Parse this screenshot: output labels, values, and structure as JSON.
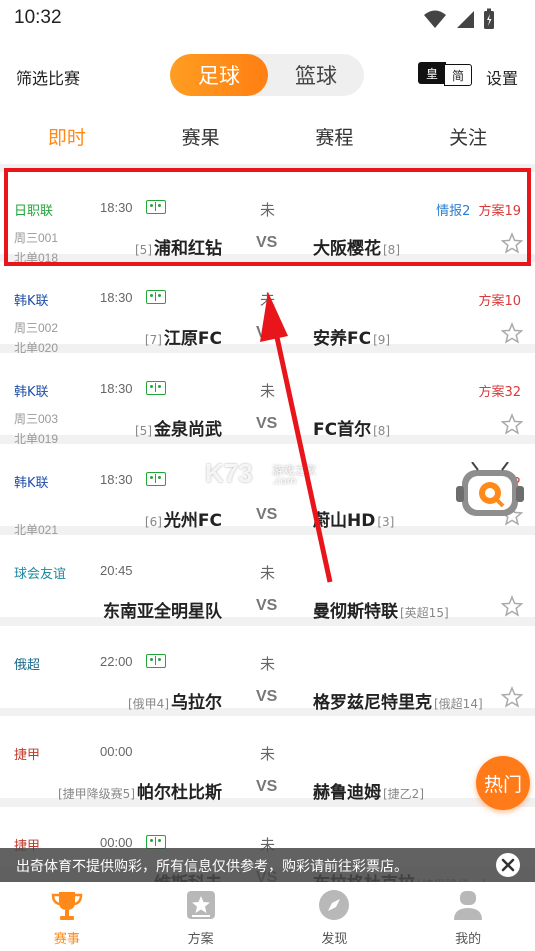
{
  "status_bar": {
    "time": "10:32"
  },
  "header": {
    "filter_label": "筛选比赛",
    "sport_tabs": [
      "足球",
      "篮球"
    ],
    "lang_trad": "皇",
    "lang_simp": "简",
    "settings_label": "设置"
  },
  "tabs": [
    "即时",
    "赛果",
    "赛程",
    "关注"
  ],
  "matches": [
    {
      "league": "日职联",
      "league_color": "#23a53a",
      "time": "18:30",
      "live": true,
      "status": "未",
      "code1": "周三001",
      "code2": "北单018",
      "home": "浦和红钻",
      "home_rank": "[5]",
      "vs": "VS",
      "away": "大阪樱花",
      "away_rank": "[8]",
      "info": "情报2",
      "plan": "方案19"
    },
    {
      "league": "韩K联",
      "league_color": "#1f4fa8",
      "time": "18:30",
      "live": true,
      "status": "未",
      "code1": "周三002",
      "code2": "北单020",
      "home": "江原FC",
      "home_rank": "[7]",
      "vs": "VS",
      "away": "安养FC",
      "away_rank": "[9]",
      "info": "",
      "plan": "方案10"
    },
    {
      "league": "韩K联",
      "league_color": "#1f4fa8",
      "time": "18:30",
      "live": true,
      "status": "未",
      "code1": "周三003",
      "code2": "北单019",
      "home": "金泉尚武",
      "home_rank": "[5]",
      "vs": "VS",
      "away": "FC首尔",
      "away_rank": "[8]",
      "info": "",
      "plan": "方案32"
    },
    {
      "league": "韩K联",
      "league_color": "#1f4fa8",
      "time": "18:30",
      "live": true,
      "status": "",
      "code1": "",
      "code2": "北单021",
      "home": "光州FC",
      "home_rank": "[6]",
      "vs": "VS",
      "away": "蔚山HD",
      "away_rank": "[3]",
      "info": "",
      "plan": "方案2"
    },
    {
      "league": "球会友谊",
      "league_color": "#1a8aa0",
      "time": "20:45",
      "live": false,
      "status": "未",
      "code1": "",
      "code2": "",
      "home": "东南亚全明星队",
      "home_rank": "",
      "vs": "VS",
      "away": "曼彻斯特联",
      "away_rank": "[英超15]",
      "info": "",
      "plan": ""
    },
    {
      "league": "俄超",
      "league_color": "#1a6a8a",
      "time": "22:00",
      "live": true,
      "status": "未",
      "code1": "",
      "code2": "",
      "home": "乌拉尔",
      "home_rank": "[俄甲4]",
      "vs": "VS",
      "away": "格罗兹尼特里克",
      "away_rank": "[俄超14]",
      "info": "",
      "plan": ""
    },
    {
      "league": "捷甲",
      "league_color": "#c0392b",
      "time": "00:00",
      "live": false,
      "status": "未",
      "code1": "",
      "code2": "",
      "home": "帕尔杜比斯",
      "home_rank": "[捷甲降级赛5]",
      "vs": "VS",
      "away": "赫鲁迪姆",
      "away_rank": "[捷乙2]",
      "info": "",
      "plan": ""
    },
    {
      "league": "捷甲",
      "league_color": "#c0392b",
      "time": "00:00",
      "live": true,
      "status": "未",
      "code1": "",
      "code2": "",
      "home": "维斯科夫",
      "home_rank": "",
      "vs": "VS",
      "away": "布拉格杜克拉",
      "away_rank": "[捷甲降级...]",
      "info": "",
      "plan": ""
    }
  ],
  "watermark": {
    "brand": "K73",
    "sub": "游戏之家",
    "domain": ".com"
  },
  "hot_button": "热门",
  "notice": "出奇体育不提供购彩，所有信息仅供参考，购彩请前往彩票店。",
  "bottom_nav": [
    "赛事",
    "方案",
    "发现",
    "我的"
  ],
  "colors": {
    "accent": "#ff8a1a",
    "highlight": "#e8151b",
    "plan": "#d83a3a",
    "info": "#2a7fd4",
    "live": "#23a53a"
  }
}
